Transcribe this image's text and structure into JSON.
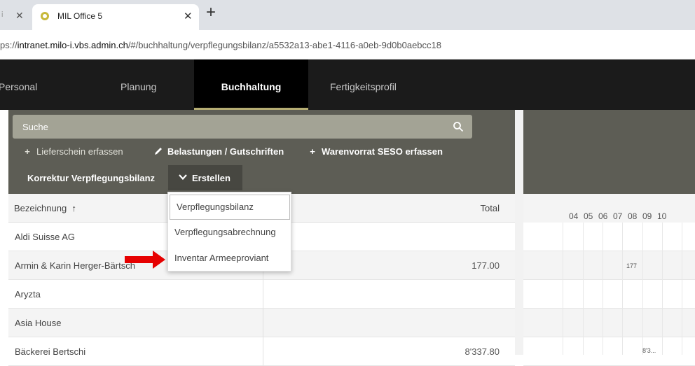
{
  "browser": {
    "prev_tab_fragment": "i",
    "active_tab_title": "MIL Office 5",
    "url_prefix": "ps://",
    "url_host": "intranet.milo-i.vbs.admin.ch",
    "url_path": "/#/buchhaltung/verpflegungsbilanz/a5532a13-abe1-4116-a0eb-9d0b0aebcc18"
  },
  "nav": {
    "items": [
      "Personal",
      "Planung",
      "Buchhaltung",
      "Fertigkeitsprofil"
    ],
    "active": "Buchhaltung"
  },
  "toolbar": {
    "search_label": "Suche",
    "lieferschein": "Lieferschein erfassen",
    "belastungen": "Belastungen / Gutschriften",
    "warenvorrat": "Warenvorrat SESO erfassen",
    "korrektur": "Korrektur Verpflegungsbilanz",
    "erstellen": "Erstellen"
  },
  "dropdown": {
    "items": [
      "Verpflegungsbilanz",
      "Verpflegungsabrechnung",
      "Inventar Armeeproviant"
    ]
  },
  "table": {
    "col_name": "Bezeichnung",
    "sort_indicator": "↑",
    "col_total": "Total",
    "rows": [
      {
        "name": "Aldi Suisse AG",
        "total": ""
      },
      {
        "name": "Armin & Karin Herger-Bärtsch",
        "total": "177.00"
      },
      {
        "name": "Aryzta",
        "total": ""
      },
      {
        "name": "Asia House",
        "total": ""
      },
      {
        "name": "Bäckerei Bertschi",
        "total": "8'337.80"
      }
    ]
  },
  "calendar": {
    "days": [
      "04",
      "05",
      "06",
      "07",
      "08",
      "09",
      "10"
    ],
    "cell_177": "177",
    "cell_8337": "8'3..."
  },
  "colors": {
    "nav_bg": "#1b1b1b",
    "panel_bg": "#5d5d55",
    "search_bg": "#a3a395",
    "accent": "#b5ad73",
    "arrow": "#e60000"
  }
}
